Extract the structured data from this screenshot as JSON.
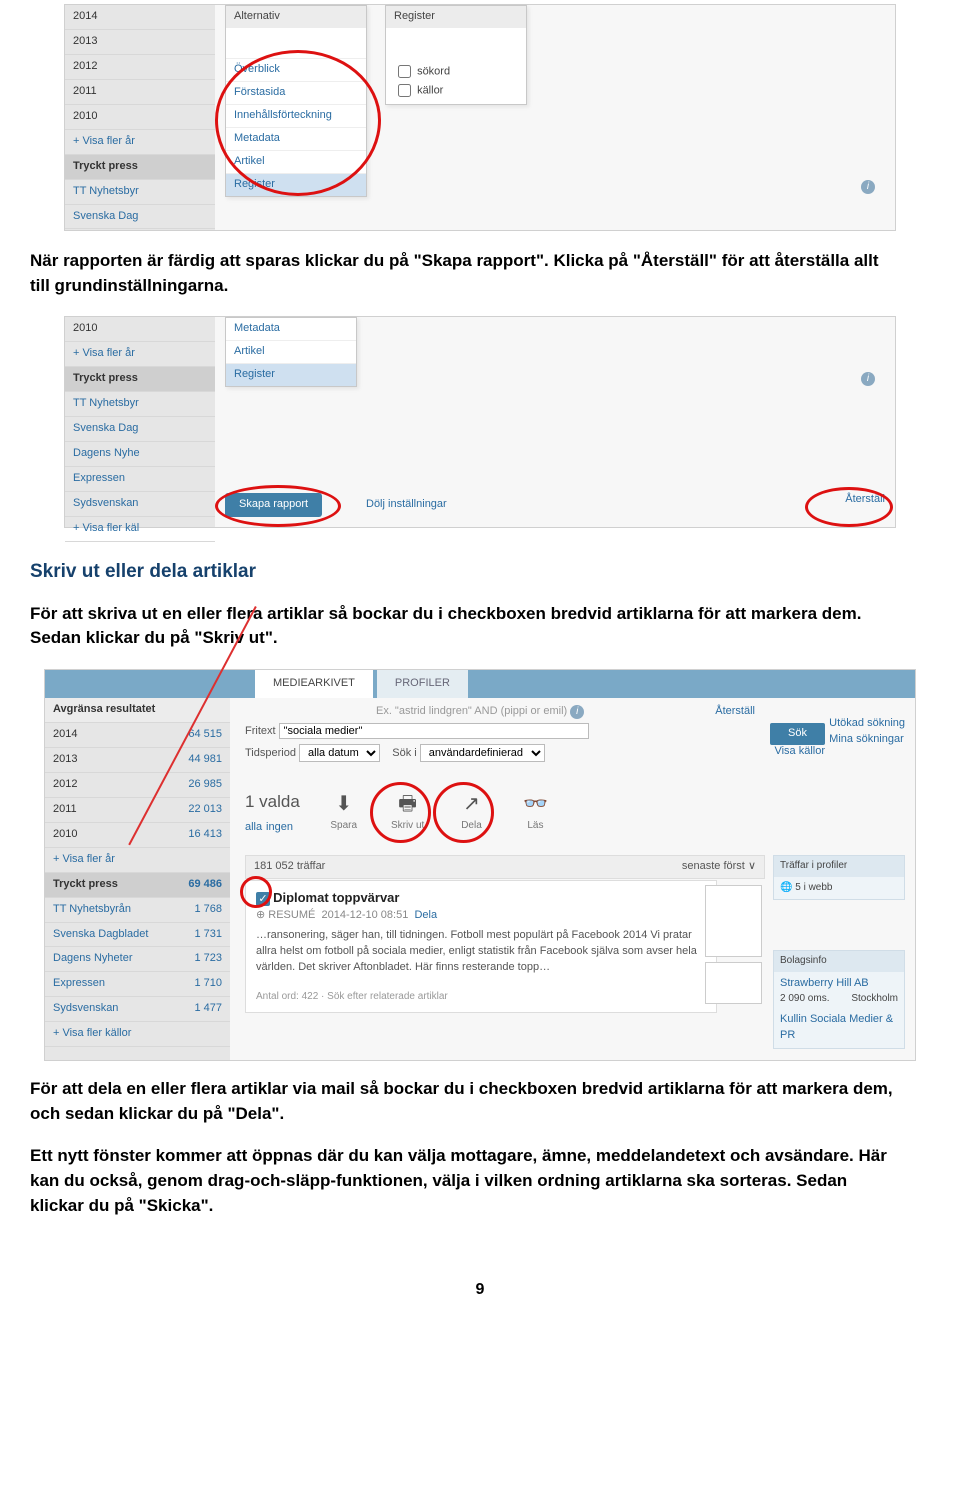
{
  "shot1": {
    "years": [
      "2014",
      "2013",
      "2012",
      "2011",
      "2010"
    ],
    "more_years": "+ Visa fler år",
    "section_press": "Tryckt press",
    "src1": "TT Nyhetsbyr",
    "src2": "Svenska Dag",
    "menu_alt_head": "Alternativ",
    "menu_alt_items": [
      "Överblick",
      "Förstasida",
      "Innehållsförteckning",
      "Metadata",
      "Artikel",
      "Register"
    ],
    "menu_reg_head": "Register",
    "cb1": "sökord",
    "cb2": "källor"
  },
  "para1": "När rapporten är färdig att sparas klickar du på \"Skapa rapport\". Klicka på \"Återställ\" för att återställa allt till grundinställningarna.",
  "shot2": {
    "year": "2010",
    "more_years": "+ Visa fler år",
    "section_press": "Tryckt press",
    "srcs": [
      "TT Nyhetsbyr",
      "Svenska Dag",
      "Dagens Nyhe",
      "Expressen",
      "Sydsvenskan"
    ],
    "more_src": "+ Visa fler käl",
    "menu_items": [
      "Metadata",
      "Artikel",
      "Register"
    ],
    "btn_create": "Skapa rapport",
    "link_hide": "Dölj inställningar",
    "link_reset": "Återställ"
  },
  "heading_section": "Skriv ut eller dela artiklar",
  "para2": "För att skriva ut en eller flera artiklar så bockar du i checkboxen bredvid artiklarna för att markera dem. Sedan klickar du på \"Skriv ut\".",
  "shot3": {
    "tab1": "MEDIEARKIVET",
    "tab2": "PROFILER",
    "left_head": "Avgränsa resultatet",
    "year_rows": [
      {
        "y": "2014",
        "c": "64 515"
      },
      {
        "y": "2013",
        "c": "44 981"
      },
      {
        "y": "2012",
        "c": "26 985"
      },
      {
        "y": "2011",
        "c": "22 013"
      },
      {
        "y": "2010",
        "c": "16 413"
      }
    ],
    "more_years": "+ Visa fler år",
    "section_press": "Tryckt press",
    "press_count": "69 486",
    "srcs": [
      {
        "n": "TT Nyhetsbyrån",
        "c": "1 768"
      },
      {
        "n": "Svenska Dagbladet",
        "c": "1 731"
      },
      {
        "n": "Dagens Nyheter",
        "c": "1 723"
      },
      {
        "n": "Expressen",
        "c": "1 710"
      },
      {
        "n": "Sydsvenskan",
        "c": "1 477"
      }
    ],
    "more_src": "+ Visa fler källor",
    "search_hint": "Ex. \"astrid lindgren\" AND (pippi or emil)",
    "lbl_fritext": "Fritext",
    "val_fritext": "\"sociala medier\"",
    "lbl_tid": "Tidsperiod",
    "val_tid": "alla datum",
    "lbl_soki": "Sök i",
    "val_soki": "användardefinierad",
    "link_reset": "Återställ",
    "btn_sok": "Sök",
    "link_utokad": "Utökad sökning",
    "link_mina": "Mina sökningar",
    "link_visakallor": "Visa källor",
    "selcount": "1 valda",
    "sel_alla": "alla",
    "sel_ingen": "ingen",
    "tool_spara": "Spara",
    "tool_skrivut": "Skriv ut",
    "tool_dela": "Dela",
    "tool_las": "Läs",
    "hits": "181 052 träffar",
    "sort": "senaste först",
    "art_title": "Diplomat toppvärvar",
    "art_meta1": "RESUMÉ",
    "art_meta2": "2014-12-10 08:51",
    "art_meta3": "Dela",
    "art_body": "…ransonering, säger han, till tidningen. Fotboll mest populärt på Facebook 2014 Vi pratar allra helst om fotboll på sociala medier, enligt statistik från Facebook själva som avser hela världen. Det skriver Aftonbladet. Här finns resterande topp…",
    "art_footer": "Antal ord: 422 · Sök efter relaterade artiklar",
    "rp1_head": "Träffar i profiler",
    "rp1_body": "5 i webb",
    "rp2_head": "Bolagsinfo",
    "rp2_b1": "Strawberry Hill AB",
    "rp2_b2": "2 090 oms.",
    "rp2_b3": "Stockholm",
    "rp2_c1": "Kullin Sociala Medier & PR"
  },
  "para3": "För att dela en eller flera artiklar via mail så bockar du i checkboxen bredvid artiklarna för att markera dem, och sedan klickar du på \"Dela\".",
  "para4": "Ett nytt fönster kommer att öppnas där du kan välja mottagare, ämne, meddelandetext och avsändare. Här kan du också, genom drag-och-släpp-funktionen, välja i vilken ordning artiklarna ska sorteras. Sedan klickar du på \"Skicka\".",
  "page_number": "9"
}
